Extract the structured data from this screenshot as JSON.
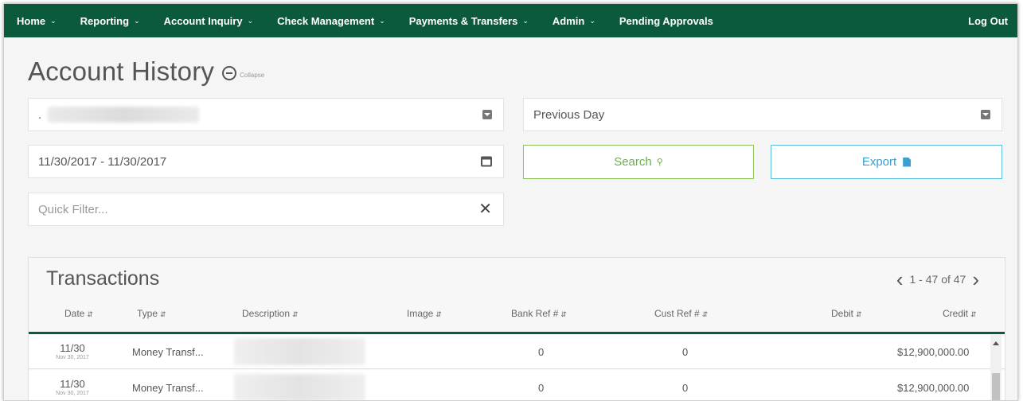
{
  "nav": {
    "items": [
      {
        "label": "Home",
        "has_menu": true
      },
      {
        "label": "Reporting",
        "has_menu": true
      },
      {
        "label": "Account Inquiry",
        "has_menu": true
      },
      {
        "label": "Check Management",
        "has_menu": true
      },
      {
        "label": "Payments & Transfers",
        "has_menu": true
      },
      {
        "label": "Admin",
        "has_menu": true
      },
      {
        "label": "Pending Approvals",
        "has_menu": false
      }
    ],
    "logout": "Log Out",
    "bg_color": "#0c5a3c"
  },
  "page": {
    "title": "Account History",
    "collapse_label": "Collapse"
  },
  "filters": {
    "account_value": ".",
    "period_value": "Previous Day",
    "date_range": "11/30/2017 - 11/30/2017",
    "quick_filter_placeholder": "Quick Filter...",
    "search_label": "Search",
    "export_label": "Export"
  },
  "transactions": {
    "title": "Transactions",
    "pager_text": "1 - 47 of 47",
    "columns": [
      "Date",
      "Type",
      "Description",
      "Image",
      "Bank Ref #",
      "Cust Ref #",
      "Debit",
      "Credit"
    ],
    "rows": [
      {
        "date": "11/30",
        "date_full": "Nov 30, 2017",
        "type": "Money Transf...",
        "bank_ref": "0",
        "cust_ref": "0",
        "debit": "",
        "credit": "$12,900,000.00"
      },
      {
        "date": "11/30",
        "date_full": "Nov 30, 2017",
        "type": "Money Transf...",
        "bank_ref": "0",
        "cust_ref": "0",
        "debit": "",
        "credit": "$12,900,000.00"
      }
    ]
  },
  "icons": {
    "collapse": "minus-circle-icon",
    "select": "dropdown-arrow-icon",
    "calendar": "calendar-icon",
    "clear": "close-icon",
    "search": "magnifier-icon",
    "export": "document-icon",
    "prev": "chevron-left-icon",
    "next": "chevron-right-icon"
  },
  "colors": {
    "search_accent": "#6ab04c",
    "export_accent": "#3aa0d0"
  }
}
